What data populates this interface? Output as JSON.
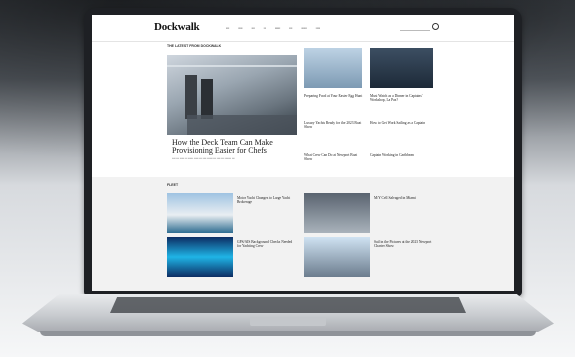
{
  "site": {
    "logo": "Dockwalk",
    "section_latest": "THE LATEST FROM DOCKWALK",
    "section_second": "FLEET"
  },
  "hero": {
    "title": "How the Deck Team Can Make Provisioning Easier for Chefs"
  },
  "side_articles": [
    {
      "title": "Preparing Food at Your Easter Egg Hunt"
    },
    {
      "title": "Must Watch as a Dinner in Captains' Workshop, La Paz?"
    },
    {
      "title": "Luxury Yachts Ready for the 2023 Boat Show"
    },
    {
      "title": "How to Get Work Sailing as a Captain"
    },
    {
      "title": "What Crew Can Do at Newport Boat Show"
    },
    {
      "title": "Captain Working in Caribbean"
    }
  ],
  "lower_articles": [
    {
      "title": "Motor Yacht Changes to Large Yacht Brokerage"
    },
    {
      "title": "M/Y Cell Salvaged in Miami"
    },
    {
      "title": "GPS/AIS Background Checks Needed for Yachting Crew"
    },
    {
      "title": "Sail in the Pictures at the 2023 Newport Charter Show"
    }
  ],
  "colors": {
    "lid": "#1e2024",
    "screen_bg": "#ffffff",
    "band_bg": "#f2f2f2"
  }
}
